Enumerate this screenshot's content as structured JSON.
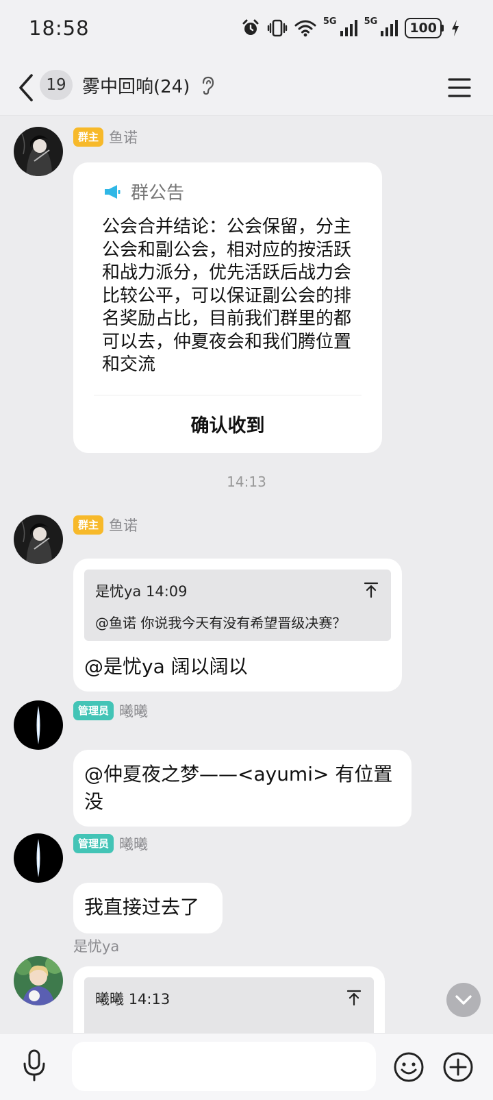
{
  "status_bar": {
    "time": "18:58",
    "battery": "100",
    "network_label_1": "5G",
    "network_label_2": "5G"
  },
  "header": {
    "unread_count": "19",
    "title": "雾中回响(24)"
  },
  "messages": [
    {
      "sender": "鱼诺",
      "role": "群主",
      "announcement_title": "群公告",
      "announcement_body": "公会合并结论：公会保留，分主公会和副公会，相对应的按活跃和战力派分，优先活跃后战力会比较公平，可以保证副公会的排名奖励占比，目前我们群里的都可以去，仲夏夜会和我们腾位置和交流",
      "confirm_label": "确认收到"
    },
    {
      "timestamp": "14:13"
    },
    {
      "sender": "鱼诺",
      "role": "群主",
      "quote_sender": "是忧ya",
      "quote_time": "14:09",
      "quote_text": "@鱼诺 你说我今天有没有希望晋级决赛？",
      "text": "@是忧ya 阔以阔以"
    },
    {
      "sender": "曦曦",
      "role": "管理员",
      "text": "@仲夏夜之梦——<ayumi> 有位置没"
    },
    {
      "sender": "曦曦",
      "role": "管理员",
      "text": "我直接过去了"
    },
    {
      "sender": "是忧ya",
      "quote_sender": "曦曦",
      "quote_time": "14:13"
    }
  ],
  "colors": {
    "owner_tag": "#f7b92a",
    "admin_tag": "#43c4b6",
    "megaphone": "#2fb7e6"
  },
  "icons": [
    "back-icon",
    "ear-icon",
    "menu-icon",
    "megaphone-icon",
    "jump-to-quote-icon",
    "chevron-down-icon",
    "microphone-icon",
    "emoji-icon",
    "plus-icon"
  ]
}
